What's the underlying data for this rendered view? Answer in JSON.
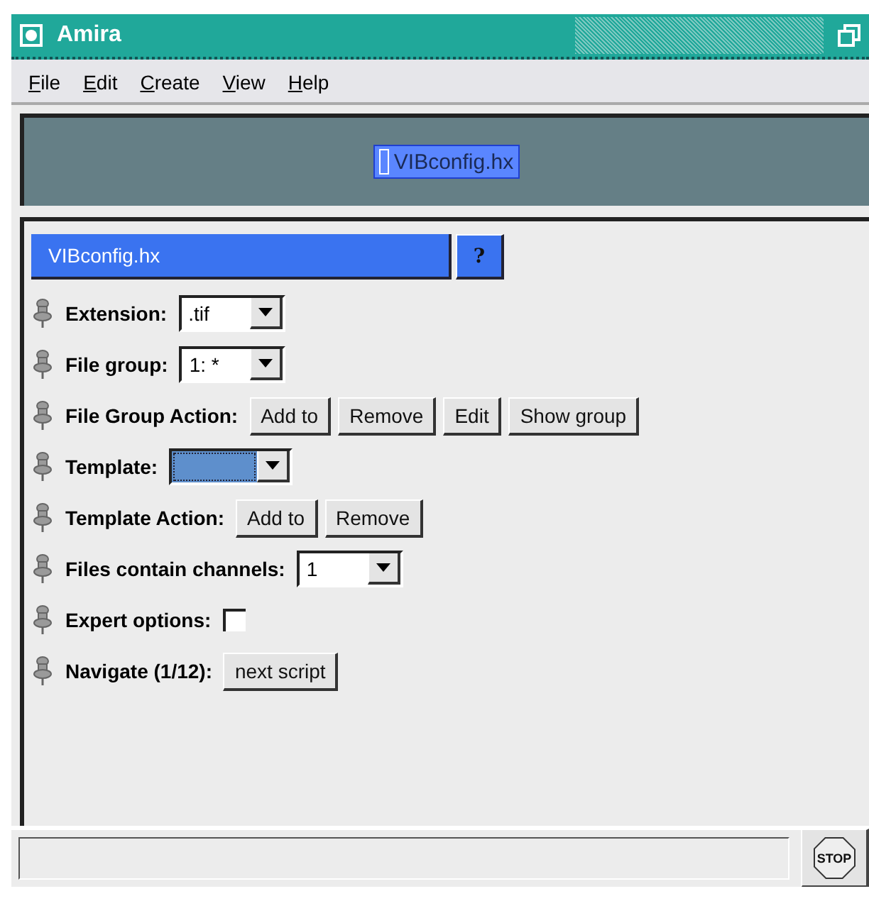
{
  "window": {
    "title": "Amira"
  },
  "menu": [
    "File",
    "Edit",
    "Create",
    "View",
    "Help"
  ],
  "pool": {
    "node": {
      "label": "VIBconfig.hx",
      "selected": true
    }
  },
  "module": {
    "title": "VIBconfig.hx",
    "help": "?"
  },
  "ports": [
    {
      "kind": "dropdown",
      "label": "Extension:",
      "value": ".tif",
      "focused": false
    },
    {
      "kind": "dropdown",
      "label": "File group:",
      "value": "1: *",
      "focused": false
    },
    {
      "kind": "buttons",
      "label": "File Group Action:",
      "buttons": [
        "Add to",
        "Remove",
        "Edit",
        "Show group"
      ]
    },
    {
      "kind": "dropdown",
      "label": "Template:",
      "focused": true
    },
    {
      "kind": "buttons",
      "label": "Template Action:",
      "buttons": [
        "Add to",
        "Remove"
      ]
    },
    {
      "kind": "dropdown",
      "label": "Files contain channels:",
      "value": "1",
      "focused": false
    },
    {
      "kind": "checkbox",
      "label": "Expert options:",
      "checked": false
    },
    {
      "kind": "buttons",
      "label": "Navigate (1/12):",
      "buttons": [
        "next script"
      ]
    }
  ],
  "status": {
    "stop": "STOP"
  }
}
